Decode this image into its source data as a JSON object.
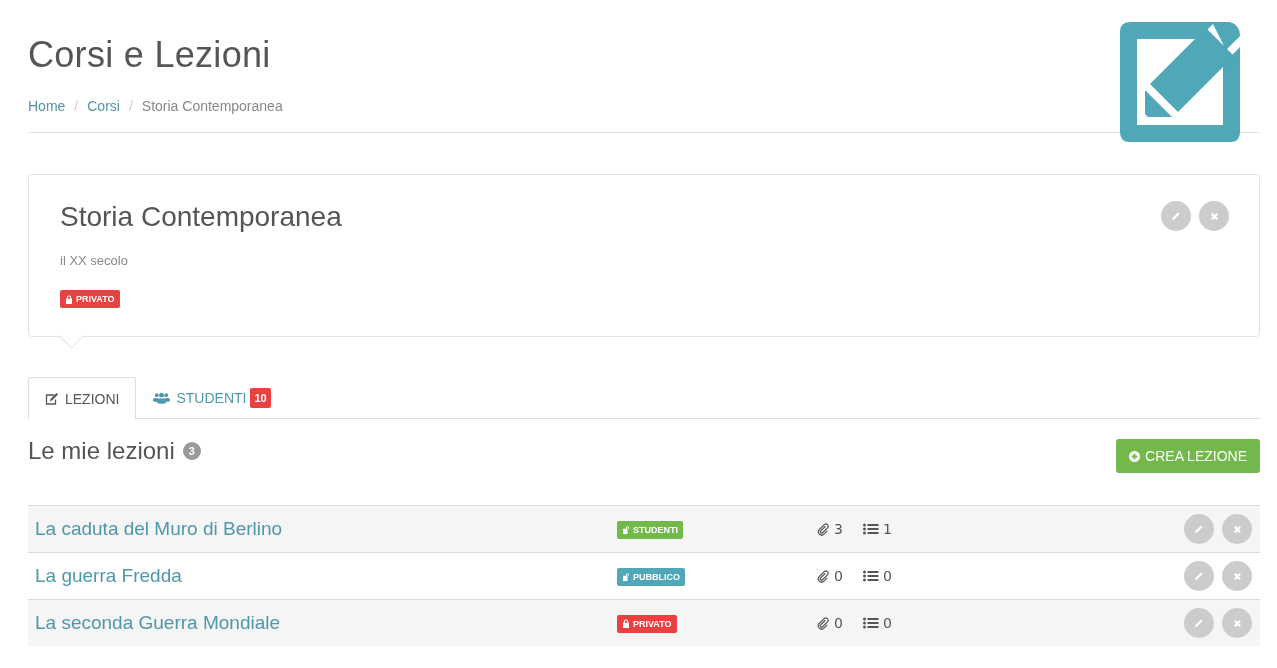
{
  "header": {
    "title": "Corsi e Lezioni",
    "separator": "/",
    "breadcrumb": [
      {
        "label": "Home",
        "link": true
      },
      {
        "label": "Corsi",
        "link": true
      },
      {
        "label": "Storia Contemporanea",
        "link": false
      }
    ]
  },
  "course": {
    "title": "Storia Contemporanea",
    "subtitle": "il XX secolo",
    "badge": {
      "kind": "privato",
      "label": "PRIVATO"
    }
  },
  "tabs": [
    {
      "label": "LEZIONI",
      "selected": true
    },
    {
      "label": "STUDENTI",
      "selected": false,
      "count": "10"
    }
  ],
  "lessons_header": {
    "title": "Le mie lezioni",
    "count": "3",
    "button": "CREA LEZIONE"
  },
  "lessons": [
    {
      "title": "La caduta del Muro di Berlino",
      "badge": {
        "kind": "studenti",
        "label": "STUDENTI"
      },
      "attachments": "3",
      "items": "1"
    },
    {
      "title": "La guerra Fredda",
      "badge": {
        "kind": "pubblico",
        "label": "PUBBLICO"
      },
      "attachments": "0",
      "items": "0"
    },
    {
      "title": "La seconda Guerra Mondiale",
      "badge": {
        "kind": "privato",
        "label": "PRIVATO"
      },
      "attachments": "0",
      "items": "0"
    }
  ]
}
